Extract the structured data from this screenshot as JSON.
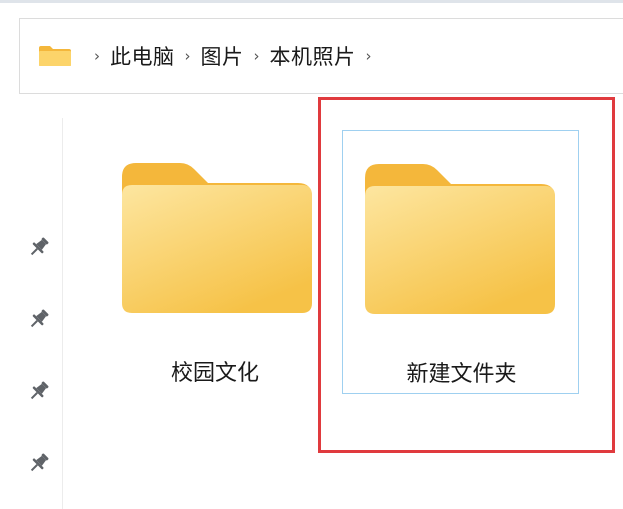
{
  "breadcrumb": {
    "folder_icon": "folder-icon",
    "separator": "›",
    "items": [
      "此电脑",
      "图片",
      "本机照片"
    ]
  },
  "sidebar": {
    "pins": [
      "pin-icon",
      "pin-icon",
      "pin-icon",
      "pin-icon"
    ]
  },
  "folders": [
    {
      "name": "校园文化",
      "icon": "folder-icon",
      "selected": false
    },
    {
      "name": "新建文件夹",
      "icon": "folder-icon",
      "selected": true
    }
  ],
  "colors": {
    "folder_tab": "#f4b73b",
    "folder_body_top": "#fde6a0",
    "folder_body_bottom": "#f6c247",
    "selection_border": "#9fd0f0",
    "highlight_box": "#e03a3e"
  }
}
